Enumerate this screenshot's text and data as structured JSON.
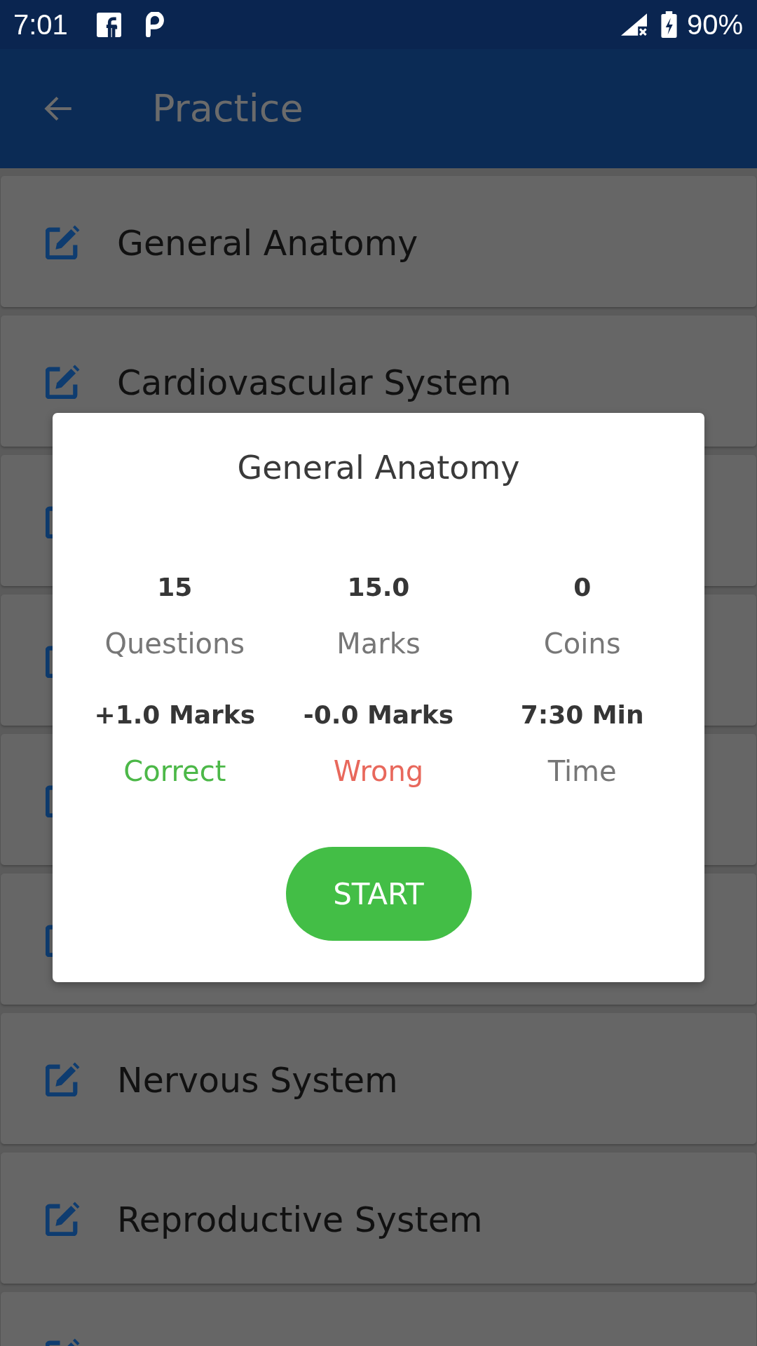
{
  "status_bar": {
    "time": "7:01",
    "battery": "90%"
  },
  "app_bar": {
    "title": "Practice"
  },
  "topics": [
    {
      "kind": "topic",
      "label": "General Anatomy"
    },
    {
      "kind": "topic",
      "label": "Cardiovascular System"
    },
    {
      "kind": "covered"
    },
    {
      "kind": "covered"
    },
    {
      "kind": "covered"
    },
    {
      "kind": "covered"
    },
    {
      "kind": "topic",
      "label": "Nervous System"
    },
    {
      "kind": "topic",
      "label": "Reproductive System"
    },
    {
      "kind": "cut"
    }
  ],
  "dialog": {
    "title": "General Anatomy",
    "stats": [
      {
        "value": "15",
        "label": "Questions"
      },
      {
        "value": "15.0",
        "label": "Marks"
      },
      {
        "value": "0",
        "label": "Coins"
      }
    ],
    "scoring": [
      {
        "value": "+1.0 Marks",
        "label": "Correct",
        "color": "#4cb848"
      },
      {
        "value": "-0.0 Marks",
        "label": "Wrong",
        "color": "#e8685c"
      },
      {
        "value": "7:30 Min",
        "label": "Time",
        "color": "#777777"
      }
    ],
    "button": "START"
  }
}
